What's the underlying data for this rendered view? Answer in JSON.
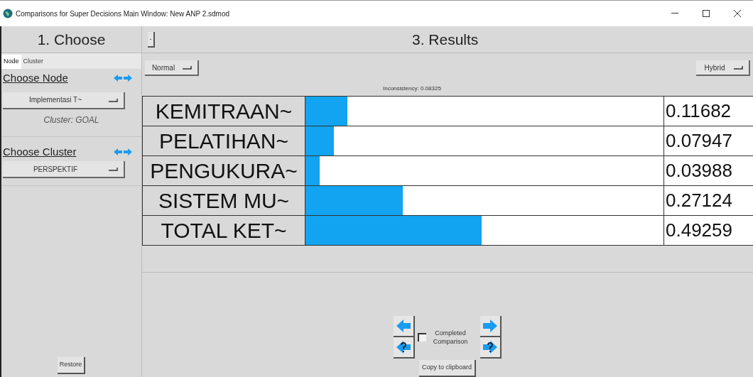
{
  "window": {
    "title": "Comparisons for Super Decisions Main Window: New ANP 2.sdmod"
  },
  "choose_panel": {
    "header": "1. Choose",
    "tabs": [
      {
        "label": "Node",
        "selected": true
      },
      {
        "label": "Cluster",
        "selected": false
      }
    ],
    "choose_node": "Choose Node",
    "node_dropdown": "Implementasi T~",
    "cluster_info": "Cluster: GOAL",
    "choose_cluster": "Choose Cluster",
    "cluster_dropdown": "PERSPEKTIF",
    "restore_button": "Restore"
  },
  "results_panel": {
    "collapse_button": "-",
    "header": "3. Results",
    "mode_dropdown": "Normal",
    "method_dropdown": "Hybrid",
    "inconsistency": "Inconsistency: 0.08325",
    "rows": [
      {
        "name": "KEMITRAAN~",
        "level": 0.11682,
        "value": "0.11682"
      },
      {
        "name": "PELATIHAN~",
        "level": 0.07947,
        "value": "0.07947"
      },
      {
        "name": "PENGUKURA~",
        "level": 0.03988,
        "value": "0.03988"
      },
      {
        "name": "SISTEM MU~",
        "level": 0.27124,
        "value": "0.27124"
      },
      {
        "name": "TOTAL KET~",
        "level": 0.49259,
        "value": "0.49259"
      }
    ],
    "completed": {
      "label": "Completed Comparison",
      "checked": false
    },
    "copy_button": "Copy to clipboard"
  }
}
